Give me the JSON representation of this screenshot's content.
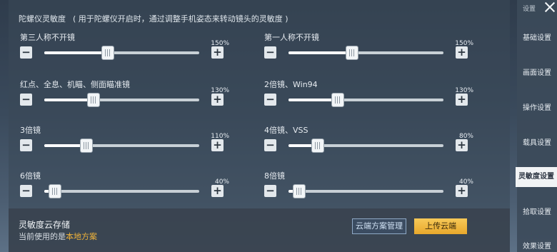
{
  "header": {
    "title": "陀螺仪灵敏度",
    "hint": "( 用于陀螺仪开启时，通过调整手机姿态来转动镜头的灵敏度 )"
  },
  "settings": [
    {
      "label": "第三人称不开镜",
      "value": "150%",
      "level": 0.41
    },
    {
      "label": "第一人称不开镜",
      "value": "150%",
      "level": 0.41
    },
    {
      "label": "红点、全息、机瞄、侧面瞄准镜",
      "value": "130%",
      "level": 0.32
    },
    {
      "label": "2倍镜、Win94",
      "value": "130%",
      "level": 0.32
    },
    {
      "label": "3倍镜",
      "value": "110%",
      "level": 0.27
    },
    {
      "label": "4倍镜、VSS",
      "value": "80%",
      "level": 0.19
    },
    {
      "label": "6倍镜",
      "value": "40%",
      "level": 0.07
    },
    {
      "label": "8倍镜",
      "value": "40%",
      "level": 0.07
    }
  ],
  "buttons": {
    "minus": "−",
    "plus": "+"
  },
  "footer": {
    "title": "灵敏度云存储",
    "current_prefix": "当前使用的是",
    "current_scheme": "本地方案",
    "cloud_manage": "云端方案管理",
    "upload": "上传云端"
  },
  "sidebar": {
    "caption": "设置",
    "items": [
      {
        "label": "基础设置",
        "active": false
      },
      {
        "label": "画面设置",
        "active": false
      },
      {
        "label": "操作设置",
        "active": false
      },
      {
        "label": "载具设置",
        "active": false
      },
      {
        "label": "灵敏度设置",
        "active": true
      },
      {
        "label": "拾取设置",
        "active": false
      },
      {
        "label": "效果设置",
        "active": false
      }
    ]
  },
  "colors": {
    "accent": "#f0b33a",
    "upload_button": "#eeb640",
    "active_tab": "#f1f3f5"
  }
}
